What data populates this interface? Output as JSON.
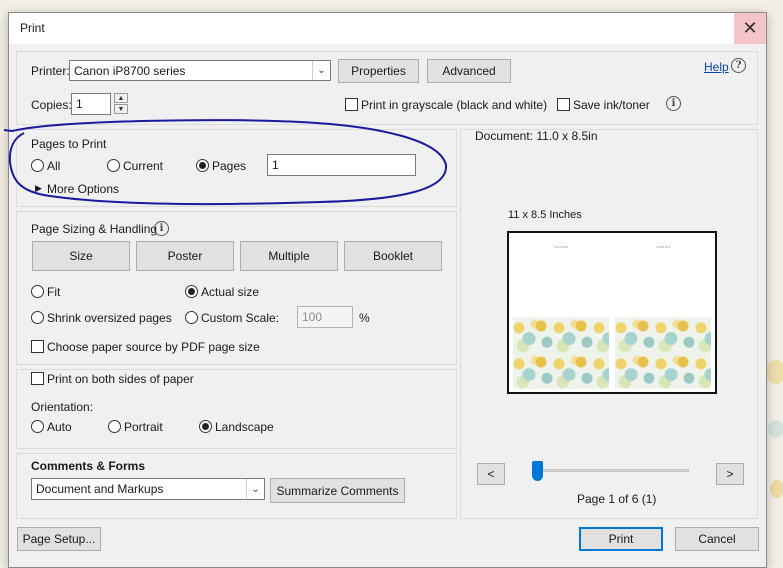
{
  "window": {
    "title": "Print",
    "close_glyph": "✕"
  },
  "printer": {
    "label": "Printer:",
    "value": "Canon iP8700 series",
    "properties_button": "Properties",
    "advanced_button": "Advanced",
    "help_link": "Help",
    "copies_label": "Copies:",
    "copies_value": "1",
    "grayscale_label": "Print in grayscale (black and white)",
    "grayscale_checked": false,
    "save_ink_label": "Save ink/toner",
    "save_ink_checked": false
  },
  "pages_to_print": {
    "heading": "Pages to Print",
    "all_label": "All",
    "current_label": "Current",
    "pages_label": "Pages",
    "pages_value": "1",
    "selected": "Pages",
    "more_options": "More Options"
  },
  "page_sizing": {
    "heading": "Page Sizing & Handling",
    "tabs": [
      "Size",
      "Poster",
      "Multiple",
      "Booklet"
    ],
    "fit_label": "Fit",
    "actual_size_label": "Actual size",
    "shrink_label": "Shrink oversized pages",
    "custom_scale_label": "Custom Scale:",
    "custom_scale_value": "100",
    "percent": "%",
    "selected": "Actual size",
    "paper_source_label": "Choose paper source by PDF page size",
    "paper_source_checked": false
  },
  "duplex": {
    "both_sides_label": "Print on both sides of paper",
    "both_sides_checked": false,
    "orientation_label": "Orientation:",
    "auto_label": "Auto",
    "portrait_label": "Portrait",
    "landscape_label": "Landscape",
    "selected": "Landscape"
  },
  "comments_forms": {
    "heading": "Comments & Forms",
    "value": "Document and Markups",
    "summarize_button": "Summarize Comments"
  },
  "preview": {
    "document_size": "Document: 11.0 x 8.5in",
    "paper_size": "11 x 8.5 Inches",
    "prev_button": "<",
    "next_button": ">",
    "page_indicator": "Page 1 of 6 (1)",
    "page_position_fraction": 0.0
  },
  "footer": {
    "page_setup_button": "Page Setup...",
    "print_button": "Print",
    "cancel_button": "Cancel"
  },
  "colors": {
    "accent": "#0078d7",
    "annotation": "#1a1aa0",
    "close_hover": "#f3c4c8"
  }
}
